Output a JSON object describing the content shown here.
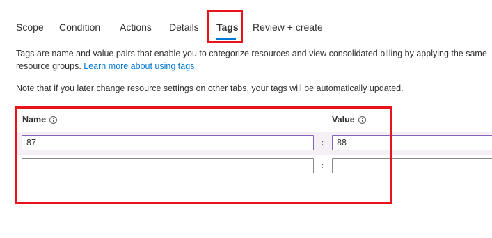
{
  "tabs": [
    {
      "label": "Scope",
      "active": false
    },
    {
      "label": "Condition",
      "active": false
    },
    {
      "label": "Actions",
      "active": false
    },
    {
      "label": "Details",
      "active": false
    },
    {
      "label": "Tags",
      "active": true
    },
    {
      "label": "Review + create",
      "active": false
    }
  ],
  "description": {
    "line1": "Tags are name and value pairs that enable you to categorize resources and view consolidated billing by applying the same",
    "line2_prefix": "resource groups. ",
    "learn_more_link": "Learn more about using tags"
  },
  "note": "Note that if you later change resource settings on other tabs, your tags will be automatically updated.",
  "tags_table": {
    "name_header": "Name",
    "value_header": "Value",
    "separator": ":",
    "rows": [
      {
        "name": "87",
        "value": "88"
      },
      {
        "name": "",
        "value": ""
      }
    ]
  },
  "colors": {
    "accent": "#0078d4",
    "highlight_box": "#e8131b",
    "active_input_border": "#8764b8",
    "row_highlight": "#f5f0f6"
  }
}
